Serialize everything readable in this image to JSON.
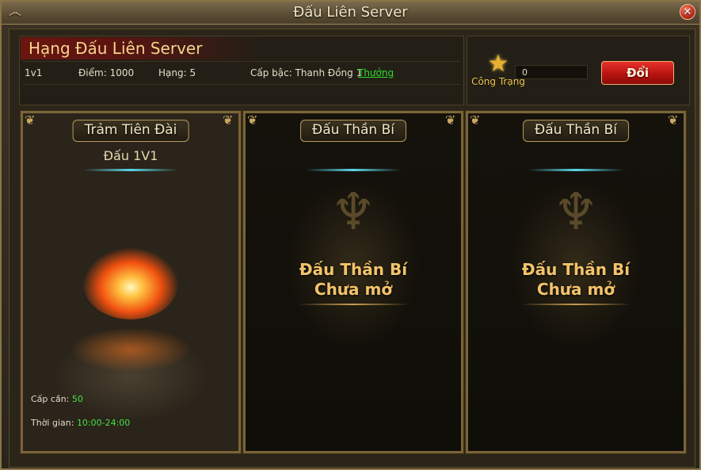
{
  "window": {
    "title": "Đấu Liên Server",
    "close_symbol": "✕"
  },
  "info": {
    "title": "Hạng Đấu Liên Server",
    "mode": "1v1",
    "points": "Điểm: 1000",
    "rank": "Hạng: 5",
    "level_label": "Cấp bậc: Thanh Đồng 1",
    "reward_link": "Thưởng"
  },
  "merit": {
    "label": "Công Trạng",
    "value": "0",
    "exchange_button": "Đổi"
  },
  "cards": [
    {
      "header": "Trảm Tiên Đài",
      "subtitle": "Đấu 1V1",
      "level_req_label": "Cấp cần:",
      "level_req_value": "50",
      "time_label": "Thời gian:",
      "time_value": "10:00-24:00"
    },
    {
      "header": "Đấu Thần Bí",
      "line1": "Đấu Thần Bí",
      "line2": "Chưa mở"
    },
    {
      "header": "Đấu Thần Bí",
      "line1": "Đấu Thần Bí",
      "line2": "Chưa mở"
    }
  ],
  "icons": {
    "close": "close-icon",
    "star": "star-icon",
    "swirl": "swirl-icon"
  },
  "colors": {
    "accent_gold": "#f3c36a",
    "reward_green": "#2fdc2f",
    "button_red": "#b81410"
  }
}
